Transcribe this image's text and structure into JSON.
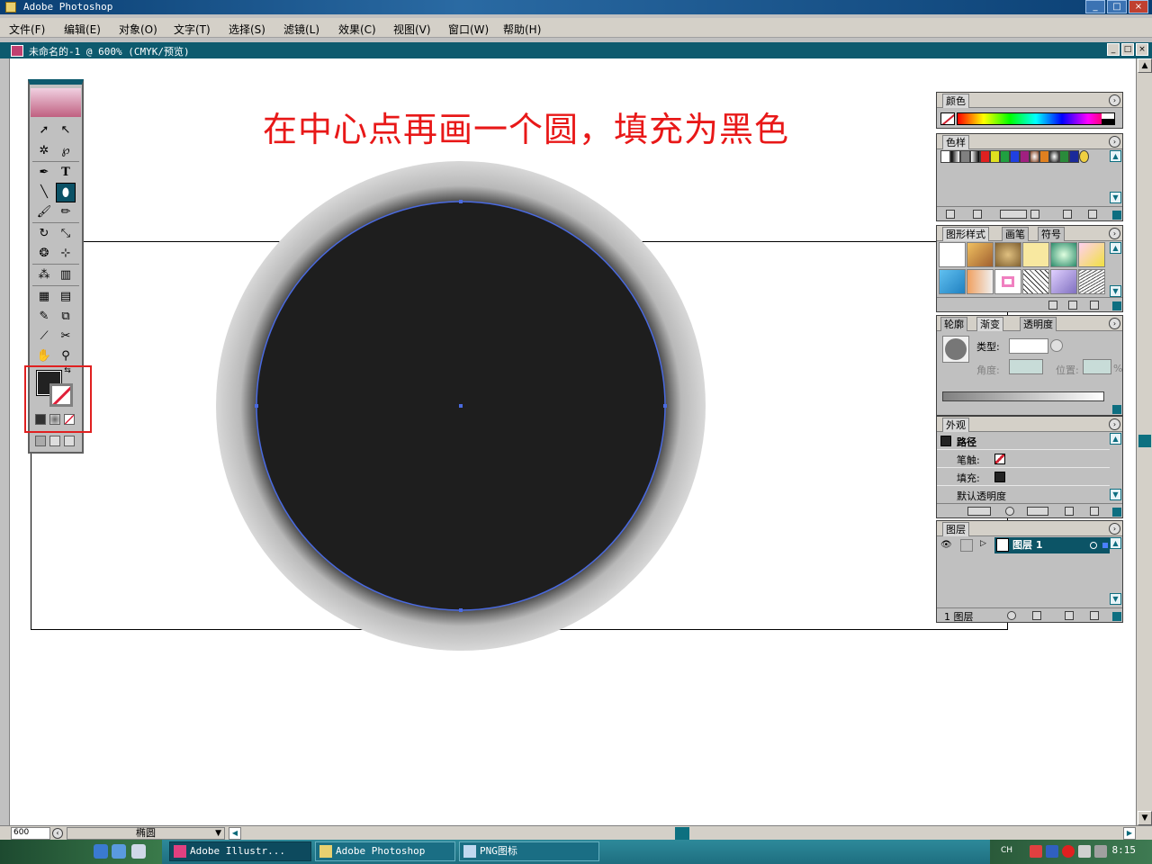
{
  "window": {
    "title": "Adobe Photoshop",
    "controls": [
      "_",
      "□",
      "×"
    ]
  },
  "menus": [
    "文件(F)",
    "编辑(E)",
    "对象(O)",
    "文字(T)",
    "选择(S)",
    "滤镜(L)",
    "效果(C)",
    "视图(V)",
    "窗口(W)",
    "帮助(H)"
  ],
  "document": {
    "title": "未命名的-1 @ 600% (CMYK/预览)"
  },
  "instruction": "在中心点再画一个圆，填充为黑色",
  "colors": {
    "accent_teal": "#0d5a6e",
    "fill_color": "#1e1e1e",
    "path_blue": "#4a6ae0",
    "instruction_red": "#e81818"
  },
  "panels": {
    "color": {
      "tab": "颜色"
    },
    "swatches": {
      "tab": "色样"
    },
    "graphic_styles": {
      "tabs": [
        "图形样式",
        "画笔",
        "符号"
      ]
    },
    "gradient": {
      "tabs": [
        "轮廓",
        "渐变",
        "透明度"
      ],
      "type_label": "类型:",
      "angle_label": "角度:",
      "position_label": "位置:",
      "percent": "%"
    },
    "appearance": {
      "tab": "外观",
      "item": "路径",
      "stroke_label": "笔触:",
      "fill_label": "填充:",
      "opacity_label": "默认透明度"
    },
    "layers": {
      "tab": "图层",
      "layer_name": "图层  1",
      "count": "1 图层"
    }
  },
  "status": {
    "zoom": "600",
    "tool": "椭圆"
  },
  "taskbar": {
    "tasks": [
      {
        "label": "Adobe Illustr...",
        "active": true
      },
      {
        "label": "Adobe Photoshop",
        "active": false
      },
      {
        "label": "PNG图标",
        "active": false
      }
    ],
    "lang": "CH",
    "clock": "8:15"
  }
}
